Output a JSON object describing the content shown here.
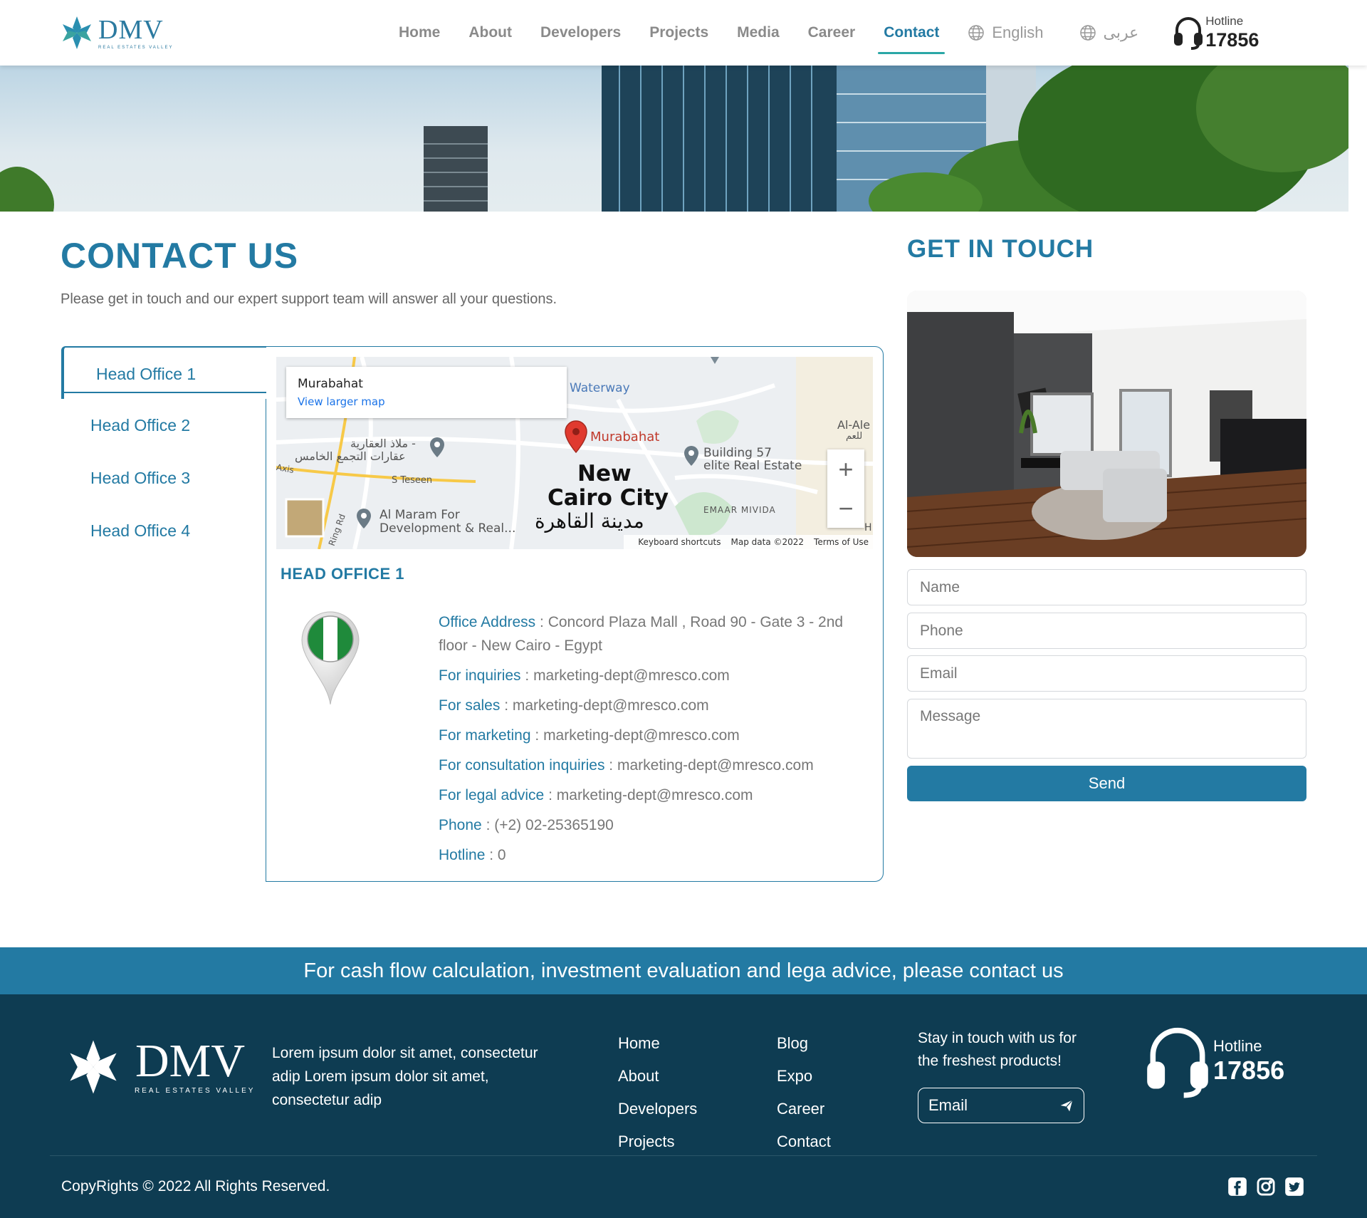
{
  "header": {
    "logo_text": "DMV",
    "logo_subtitle": "REAL ESTATES VALLEY",
    "nav": [
      {
        "label": "Home"
      },
      {
        "label": "About"
      },
      {
        "label": "Developers"
      },
      {
        "label": "Projects"
      },
      {
        "label": "Media"
      },
      {
        "label": "Career"
      },
      {
        "label": "Contact",
        "active": true
      }
    ],
    "lang_en": "English",
    "lang_ar": "عربى",
    "hotline_label": "Hotline",
    "hotline_number": "17856"
  },
  "contact": {
    "title": "CONTACT US",
    "subtitle": "Please get in touch and our expert support team will answer all your questions.",
    "tabs": [
      "Head Office 1",
      "Head Office 2",
      "Head Office 3",
      "Head Office 4"
    ],
    "active_tab": "Head Office 1",
    "map": {
      "card_title": "Murabahat",
      "card_link": "View larger map",
      "labels": {
        "waterway": "Waterway",
        "murabahat": "Murabahat",
        "alale": "Al-Ale",
        "alale_ar": "للعم",
        "malad_1": "ملاذ العقارية -",
        "malad_2": "عقارات التجمع الخامس",
        "building57_1": "Building 57",
        "building57_2": "elite Real Estate",
        "axis": "Axis",
        "steseen": "S Teseen",
        "city_1": "New",
        "city_2": "Cairo City",
        "city_ar": "مدينة القاهرة",
        "emaar": "EMAAR MIVIDA",
        "almaram_1": "Al Maram For",
        "almaram_2": "Development & Real...",
        "ringrd": "Ring Rd",
        "h": "H"
      },
      "footer_shortcuts": "Keyboard shortcuts",
      "footer_data": "Map data ©2022",
      "footer_terms": "Terms of Use"
    },
    "office": {
      "title": "HEAD OFFICE 1",
      "rows": [
        {
          "key": "Office Address",
          "value": "Concord Plaza Mall , Road 90 - Gate 3 - 2nd floor - New Cairo - Egypt"
        },
        {
          "key": "For inquiries",
          "value": "marketing-dept@mresco.com"
        },
        {
          "key": "For sales",
          "value": "marketing-dept@mresco.com"
        },
        {
          "key": "For marketing",
          "value": "marketing-dept@mresco.com"
        },
        {
          "key": "For consultation inquiries",
          "value": "marketing-dept@mresco.com"
        },
        {
          "key": "For legal advice",
          "value": "marketing-dept@mresco.com"
        },
        {
          "key": "Phone",
          "value": "(+2) 02-25365190"
        },
        {
          "key": "Hotline",
          "value": "0"
        }
      ]
    }
  },
  "get_in_touch": {
    "title": "GET IN TOUCH",
    "name_placeholder": "Name",
    "phone_placeholder": "Phone",
    "email_placeholder": "Email",
    "message_placeholder": "Message",
    "send_label": "Send"
  },
  "footer": {
    "cta": "For cash flow calculation, investment evaluation and lega advice, please contact us",
    "logo_text": "DMV",
    "logo_subtitle": "REAL ESTATES VALLEY",
    "description": "Lorem ipsum dolor sit amet, consectetur adip Lorem ipsum dolor sit amet, consectetur adip",
    "links_col1": [
      "Home",
      "About",
      "Developers",
      "Projects"
    ],
    "links_col2": [
      "Blog",
      "Expo",
      "Career",
      "Contact"
    ],
    "stay_text": "Stay in touch with us for the freshest products!",
    "email_placeholder": "Email",
    "hotline_label": "Hotline",
    "hotline_number": "17856",
    "copyright": "CopyRights © 2022 All Rights Reserved."
  },
  "colors": {
    "primary": "#237aa3",
    "footer_bg": "#0e3c52",
    "nav_inactive": "#8a8a8a",
    "active_underline": "#2aa7a6"
  },
  "icons": [
    "globe-icon",
    "headset-icon",
    "map-pin-icon",
    "send-icon",
    "facebook-icon",
    "instagram-icon",
    "twitter-icon"
  ]
}
